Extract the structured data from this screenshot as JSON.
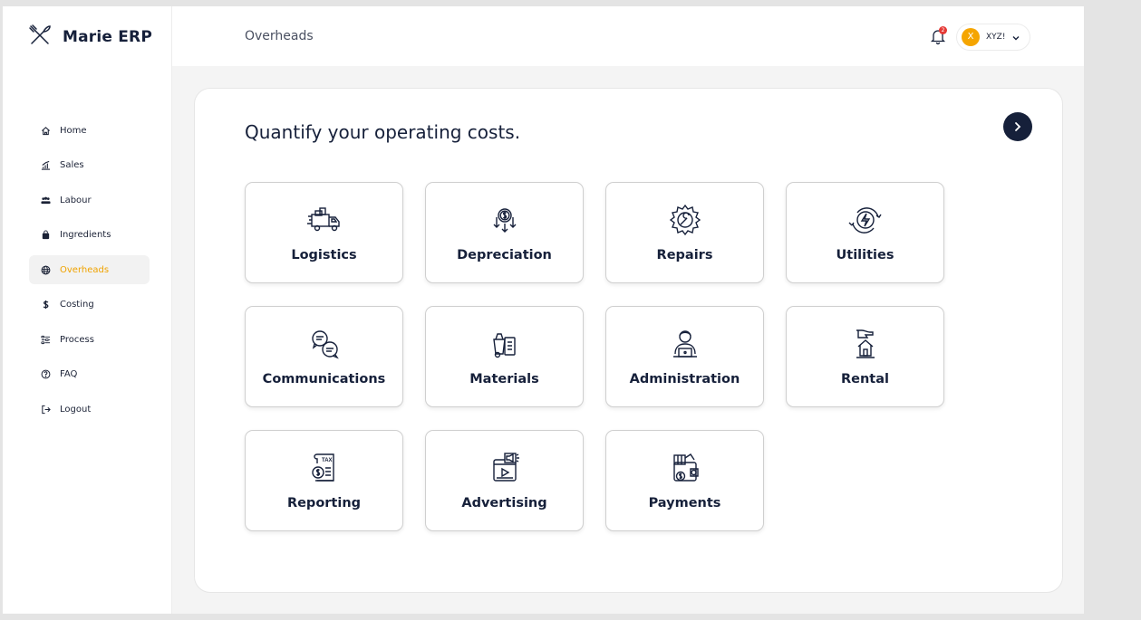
{
  "app": {
    "name": "Marie ERP"
  },
  "header": {
    "title": "Overheads",
    "notification_count": "2",
    "user_initial": "X",
    "user_name": "XYZ!"
  },
  "sidebar": {
    "items": [
      {
        "label": "Home",
        "icon": "home-icon"
      },
      {
        "label": "Sales",
        "icon": "chart-icon"
      },
      {
        "label": "Labour",
        "icon": "users-icon"
      },
      {
        "label": "Ingredients",
        "icon": "bag-icon"
      },
      {
        "label": "Overheads",
        "icon": "globe-icon",
        "active": true
      },
      {
        "label": "Costing",
        "icon": "dollar-icon"
      },
      {
        "label": "Process",
        "icon": "process-icon"
      },
      {
        "label": "FAQ",
        "icon": "help-icon"
      },
      {
        "label": "Logout",
        "icon": "logout-icon"
      }
    ]
  },
  "main": {
    "heading": "Quantify your operating costs.",
    "tiles": [
      {
        "label": "Logistics",
        "icon": "truck-icon"
      },
      {
        "label": "Depreciation",
        "icon": "depreciation-icon"
      },
      {
        "label": "Repairs",
        "icon": "gear-wrench-icon"
      },
      {
        "label": "Utilities",
        "icon": "power-icon"
      },
      {
        "label": "Communications",
        "icon": "chat-icon"
      },
      {
        "label": "Materials",
        "icon": "materials-icon"
      },
      {
        "label": "Administration",
        "icon": "admin-icon"
      },
      {
        "label": "Rental",
        "icon": "rental-house-icon"
      },
      {
        "label": "Reporting",
        "icon": "tax-report-icon"
      },
      {
        "label": "Advertising",
        "icon": "megaphone-video-icon"
      },
      {
        "label": "Payments",
        "icon": "wallet-icon"
      }
    ]
  },
  "colors": {
    "accent": "#f0a300",
    "navy": "#16203a",
    "badge": "#e53935"
  }
}
